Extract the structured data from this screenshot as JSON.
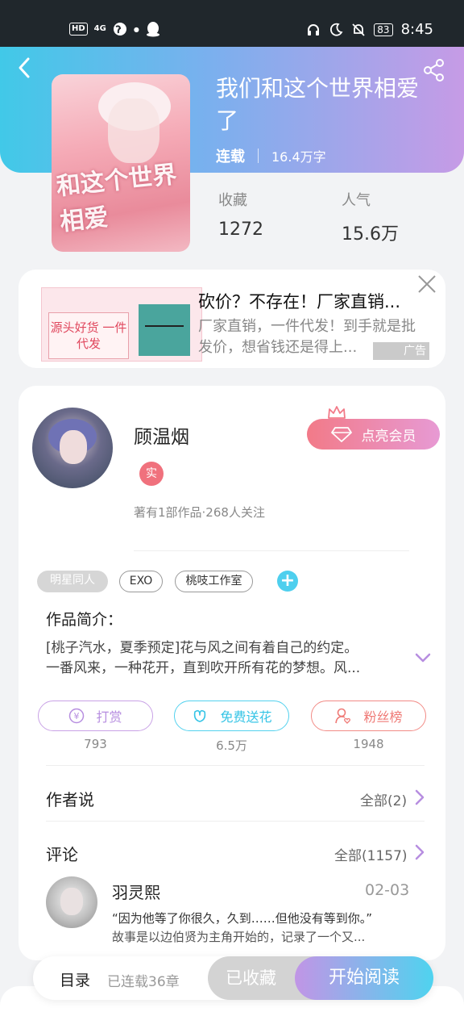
{
  "status_bar": {
    "left_icons": [
      "hd-icon",
      "signal-4g-icon",
      "globe-icon",
      "dot-icon",
      "qq-icon"
    ],
    "hd_label": "HD",
    "network_label": "4G",
    "battery_level": "83",
    "time": "8:45"
  },
  "book": {
    "title": "我们和这个世界相爱了",
    "status": "连载",
    "word_count": "16.4万字",
    "cover_text": "和这个世界相爱",
    "stats": [
      {
        "label": "收藏",
        "value": "1272"
      },
      {
        "label": "人气",
        "value": "15.6万"
      }
    ]
  },
  "ad": {
    "image_text": "源头好货 一件代发",
    "title": "砍价？不存在！厂家直销...",
    "description": "厂家直销，一件代发！到手就是批发价，想省钱还是得上...",
    "label": "广告"
  },
  "author": {
    "name": "顾温烟",
    "badge": "实",
    "info": "著有1部作品·268人关注",
    "vip_button": "点亮会员"
  },
  "tags": [
    "明星同人",
    "EXO",
    "桃吱工作室"
  ],
  "intro": {
    "heading": "作品简介：",
    "text_line1": "[桃子汽水，夏季预定]花与风之间有着自己的约定。",
    "text_line2": "一番风来，一种花开，直到吹开所有花的梦想。风..."
  },
  "actions": [
    {
      "label": "打赏",
      "count": "793"
    },
    {
      "label": "免费送花",
      "count": "6.5万"
    },
    {
      "label": "粉丝榜",
      "count": "1948"
    }
  ],
  "author_says": {
    "title": "作者说",
    "more": "全部(2)"
  },
  "comments": {
    "title": "评论",
    "more": "全部(1157)",
    "first": {
      "name": "羽灵熙",
      "date": "02-03",
      "quote": "“因为他等了你很久，久到……但他没有等到你。”",
      "text": "故事是以边伯贤为主角开始的，记录了一个又..."
    }
  },
  "bottom_bar": {
    "toc_label": "目录",
    "toc_count": "已连载36章",
    "favorited_label": "已收藏",
    "read_label": "开始阅读"
  },
  "colors": {
    "header_gradient_start": "#41c9e8",
    "header_gradient_end": "#c69be6",
    "vip_pink": "#f27a88",
    "accent_cyan": "#4ecfee",
    "accent_purple": "#c195e6"
  }
}
